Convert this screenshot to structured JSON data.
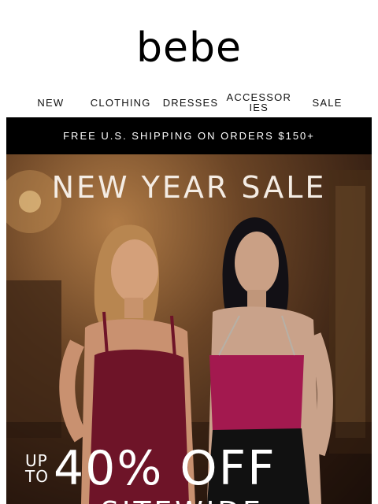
{
  "brand": {
    "logo": "bebe"
  },
  "nav": {
    "items": [
      {
        "label": "NEW"
      },
      {
        "label": "CLOTHING"
      },
      {
        "label": "DRESSES"
      },
      {
        "label": "ACCESSOR IES"
      },
      {
        "label": "SALE"
      }
    ]
  },
  "promo_bar": {
    "text": "FREE U.S. SHIPPING ON ORDERS $150+"
  },
  "hero": {
    "title": "NEW YEAR SALE",
    "offer_up": "UP",
    "offer_to": "TO",
    "offer_main": "40% OFF",
    "offer_sub": "SITEWIDE"
  },
  "colors": {
    "promo_bar_bg": "#000000",
    "dress_left": "#6e1428",
    "top_right": "#a3194f"
  }
}
